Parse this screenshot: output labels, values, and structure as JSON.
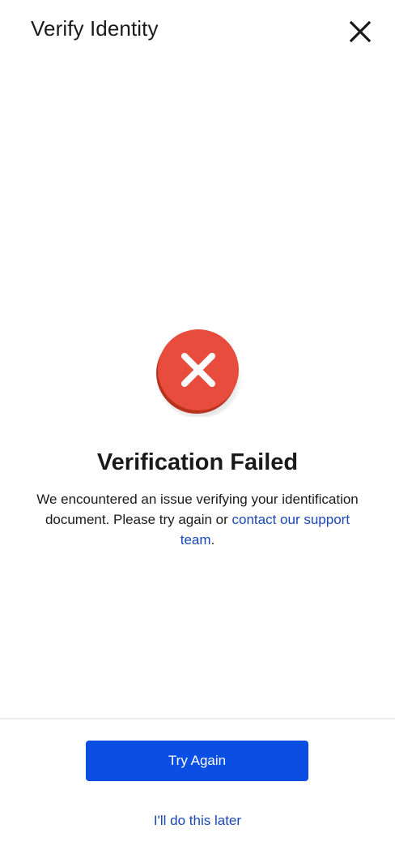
{
  "header": {
    "title": "Verify Identity",
    "close_icon": "close-icon"
  },
  "main": {
    "status_icon": "error-x-circle-icon",
    "title": "Verification Failed",
    "message_prefix": "We encountered an issue verifying your identification document. Please try again or ",
    "message_link": "contact our support team",
    "message_suffix": "."
  },
  "footer": {
    "primary_label": "Try Again",
    "secondary_label": "I'll do this later"
  },
  "colors": {
    "primary": "#0a4ee4",
    "link": "#1a47b8",
    "error": "#e84c3d",
    "error_shadow": "#b7321f"
  }
}
